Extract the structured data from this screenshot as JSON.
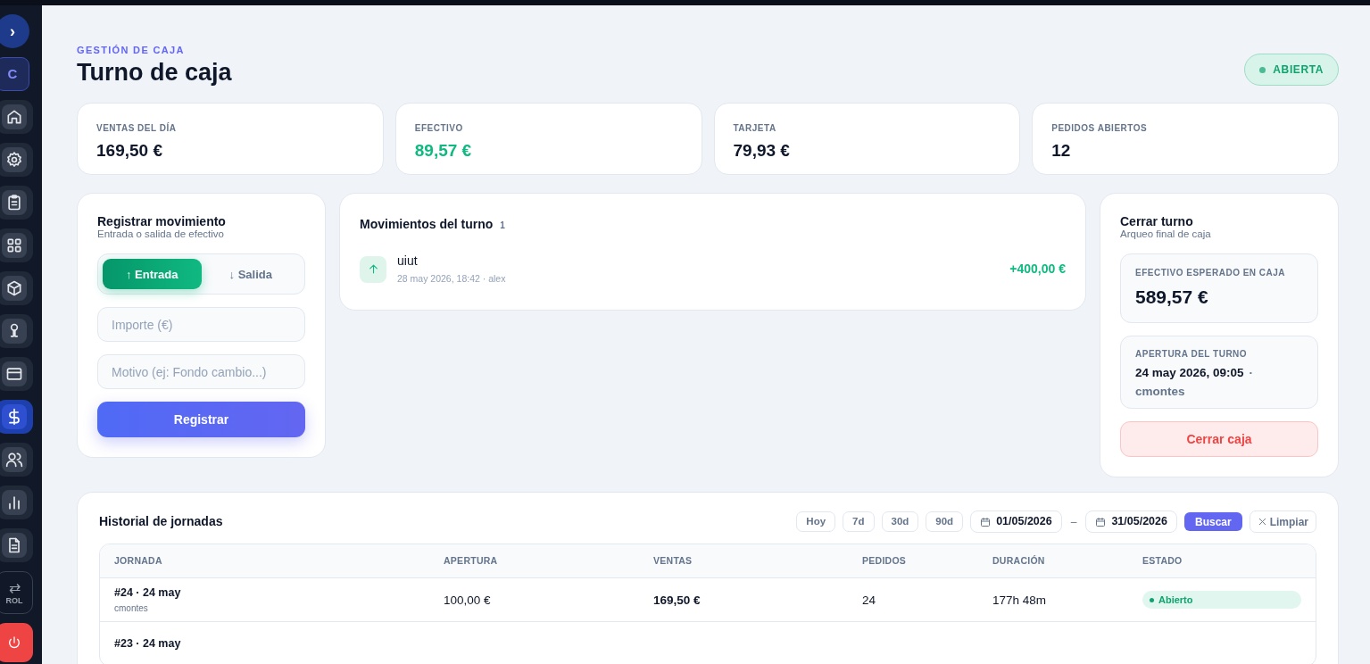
{
  "sidebar": {
    "toggle": "›",
    "logo": "C",
    "items": [
      {
        "selected": false
      },
      {
        "selected": false
      },
      {
        "selected": false
      },
      {
        "selected": false
      },
      {
        "selected": false
      },
      {
        "selected": false
      },
      {
        "selected": false
      },
      {
        "selected": true
      },
      {
        "selected": false
      },
      {
        "selected": false
      },
      {
        "selected": false
      }
    ],
    "role": {
      "icon": "⇄",
      "label": "ROL"
    }
  },
  "header": {
    "eyebrow": "GESTIÓN DE CAJA",
    "title": "Turno de caja",
    "status": {
      "label": "ABIERTA",
      "kind": "open"
    }
  },
  "stats": [
    {
      "label": "VENTAS DEL DÍA",
      "value": "169,50 €",
      "kind": "plain"
    },
    {
      "label": "EFECTIVO",
      "value": "89,57 €",
      "kind": "positive"
    },
    {
      "label": "TARJETA",
      "value": "79,93 €",
      "kind": "plain"
    },
    {
      "label": "PEDIDOS ABIERTOS",
      "value": "12",
      "kind": "plain"
    }
  ],
  "register": {
    "title": "Registrar movimiento",
    "subtitle": "Entrada o salida de efectivo",
    "types": [
      {
        "label": "↑ Entrada",
        "selected": true
      },
      {
        "label": "↓ Salida",
        "selected": false
      }
    ],
    "amount_placeholder": "Importe (€)",
    "reason_placeholder": "Motivo (ej: Fondo cambio...)",
    "submit": "Registrar"
  },
  "movements": {
    "title": "Movimientos del turno",
    "count": "1",
    "items": [
      {
        "name": "uiut",
        "meta": "28 may 2026, 18:42 · alex",
        "amount": "+400,00 €",
        "kind": "in"
      }
    ]
  },
  "close": {
    "title": "Cerrar turno",
    "subtitle": "Arqueo final de caja",
    "expected_label": "EFECTIVO ESPERADO EN CAJA",
    "expected_value": "589,57 €",
    "opening_label": "APERTURA DEL TURNO",
    "opening_date": "24 may 2026, 09:05",
    "opening_separator": "·",
    "opening_user": "cmontes",
    "button": "Cerrar caja"
  },
  "history": {
    "title": "Historial de jornadas",
    "ranges": [
      "Hoy",
      "7d",
      "30d",
      "90d"
    ],
    "from": "01/05/2026",
    "separator": "–",
    "to": "31/05/2026",
    "search": "Buscar",
    "clear": "Limpiar",
    "columns": [
      "JORNADA",
      "APERTURA",
      "VENTAS",
      "PEDIDOS",
      "DURACIÓN",
      "ESTADO"
    ],
    "rows": [
      {
        "jornada": "#24 · 24 may",
        "user": "cmontes",
        "apertura": "100,00 €",
        "ventas": "169,50 €",
        "pedidos": "24",
        "duracion": "177h 48m",
        "estado": {
          "label": "Abierto",
          "kind": "open"
        }
      },
      {
        "jornada": "#23 · 24 may"
      }
    ]
  }
}
